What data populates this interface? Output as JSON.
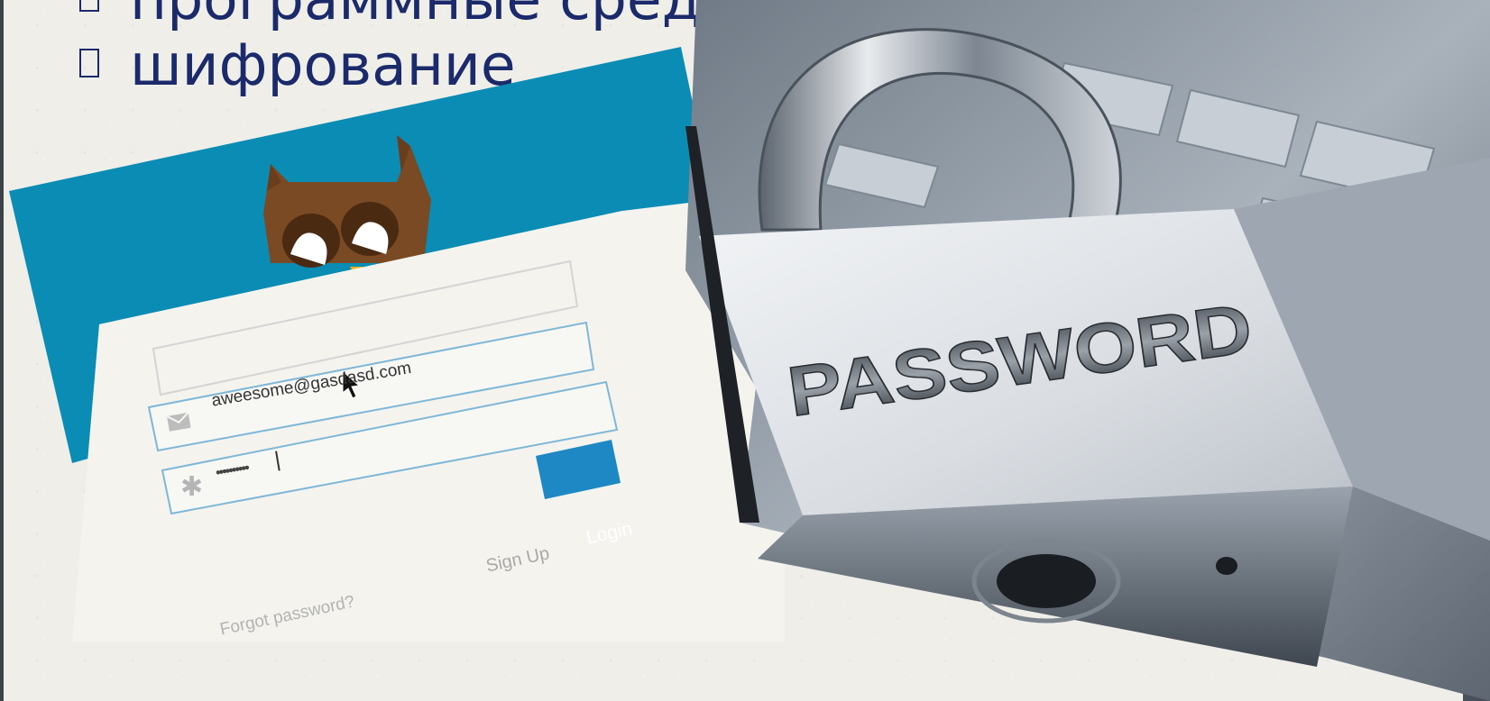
{
  "slide": {
    "bullets": [
      {
        "text": "программные средства"
      },
      {
        "text": "шифрование"
      }
    ]
  },
  "login_screenshot": {
    "email_value": "aweesome@gasdasd.com",
    "password_mask": "••••••••••",
    "login_button": "Login",
    "signup_link": "Sign Up",
    "forgot_link": "Forgot password?"
  },
  "lock_photo": {
    "engraving": "PASSWORD"
  },
  "colors": {
    "bullet_text": "#1b2a6b",
    "login_header": "#0a8cb5",
    "login_button": "#1d88c3"
  }
}
